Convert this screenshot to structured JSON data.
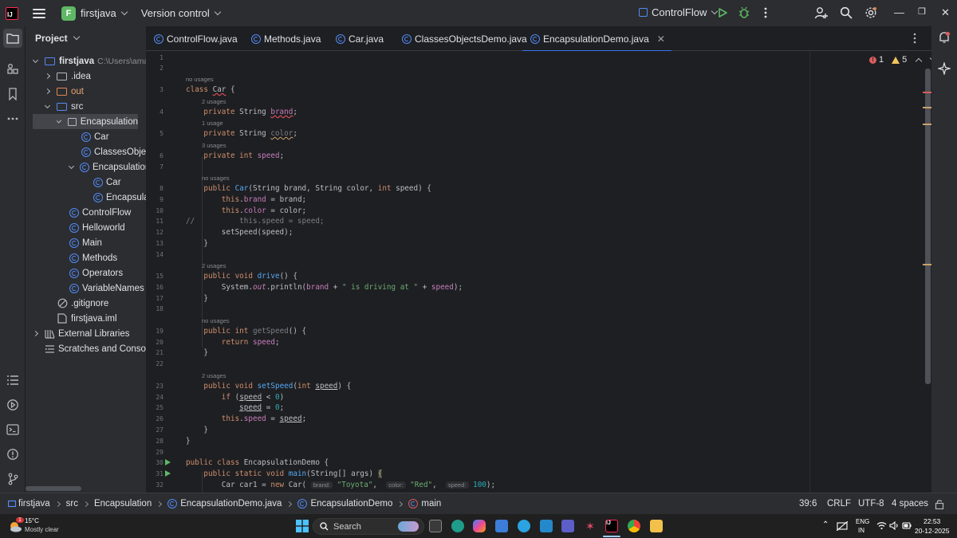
{
  "titlebar": {
    "project_initial": "F",
    "project_name": "firstjava",
    "vcs": "Version control",
    "run_config": "ControlFlow"
  },
  "project_panel": {
    "title": "Project",
    "tree": [
      {
        "label": "firstjava",
        "extra": "C:\\Users\\amarh",
        "type": "module",
        "depth": 0,
        "expanded": true
      },
      {
        "label": ".idea",
        "type": "folder",
        "depth": 1,
        "expanded": false
      },
      {
        "label": "out",
        "type": "folder",
        "depth": 1,
        "expanded": false
      },
      {
        "label": "src",
        "type": "folder",
        "depth": 1,
        "expanded": true
      },
      {
        "label": "Encapsulation",
        "type": "package",
        "depth": 2,
        "expanded": true,
        "selected": true
      },
      {
        "label": "Car",
        "type": "class",
        "depth": 3
      },
      {
        "label": "ClassesObjectsD",
        "type": "class",
        "depth": 3
      },
      {
        "label": "EncapsulationD",
        "type": "class",
        "depth": 3,
        "expanded": true
      },
      {
        "label": "Car",
        "type": "class",
        "depth": 4
      },
      {
        "label": "Encapsulatio",
        "type": "class",
        "depth": 4
      },
      {
        "label": "ControlFlow",
        "type": "class",
        "depth": 2
      },
      {
        "label": "Helloworld",
        "type": "class",
        "depth": 2
      },
      {
        "label": "Main",
        "type": "class",
        "depth": 2
      },
      {
        "label": "Methods",
        "type": "class",
        "depth": 2
      },
      {
        "label": "Operators",
        "type": "class",
        "depth": 2
      },
      {
        "label": "VariableNames",
        "type": "class",
        "depth": 2
      },
      {
        "label": ".gitignore",
        "type": "gitignore",
        "depth": 1
      },
      {
        "label": "firstjava.iml",
        "type": "file",
        "depth": 1
      },
      {
        "label": "External Libraries",
        "type": "library",
        "depth": 0,
        "expanded": false
      },
      {
        "label": "Scratches and Consoles",
        "type": "scratch",
        "depth": 0
      }
    ]
  },
  "tabs": [
    {
      "label": "ControlFlow.java",
      "active": false
    },
    {
      "label": "Methods.java",
      "active": false
    },
    {
      "label": "Car.java",
      "active": false
    },
    {
      "label": "ClassesObjectsDemo.java",
      "active": false
    },
    {
      "label": "EncapsulationDemo.java",
      "active": true
    }
  ],
  "inspections": {
    "errors": "1",
    "warnings": "5"
  },
  "editor": {
    "line_numbers": [
      "1",
      "2",
      "3",
      "4",
      "5",
      "6",
      "7",
      "8",
      "9",
      "10",
      "11",
      "12",
      "13",
      "14",
      "15",
      "16",
      "17",
      "18",
      "19",
      "20",
      "21",
      "22",
      "23",
      "24",
      "25",
      "26",
      "27",
      "28",
      "29",
      "30",
      "31",
      "32"
    ],
    "hints": {
      "h3": "no usages",
      "h4": "2 usages",
      "h5": "1 usage",
      "h6": "3 usages",
      "h8": "no usages",
      "h15": "2 usages",
      "h19": "no usages",
      "h23": "2 usages"
    },
    "inlay": {
      "brand": "brand:",
      "color": "color:",
      "speed": "speed:"
    }
  },
  "statusbar": {
    "crumbs": [
      "firstjava",
      "src",
      "Encapsulation",
      "EncapsulationDemo.java",
      "EncapsulationDemo",
      "main"
    ],
    "position": "39:6",
    "line_sep": "CRLF",
    "encoding": "UTF-8",
    "indent": "4 spaces"
  },
  "taskbar": {
    "weather_temp": "15°C",
    "weather_desc": "Mostly clear",
    "weather_badge": "1",
    "search": "Search",
    "lang": "ENG",
    "region": "IN",
    "time": "22:53",
    "date": "20-12-2025"
  },
  "colors": {
    "accent": "#3574f0",
    "run": "#5fb865",
    "error": "#db5c5c",
    "warning": "#f2c55c"
  }
}
